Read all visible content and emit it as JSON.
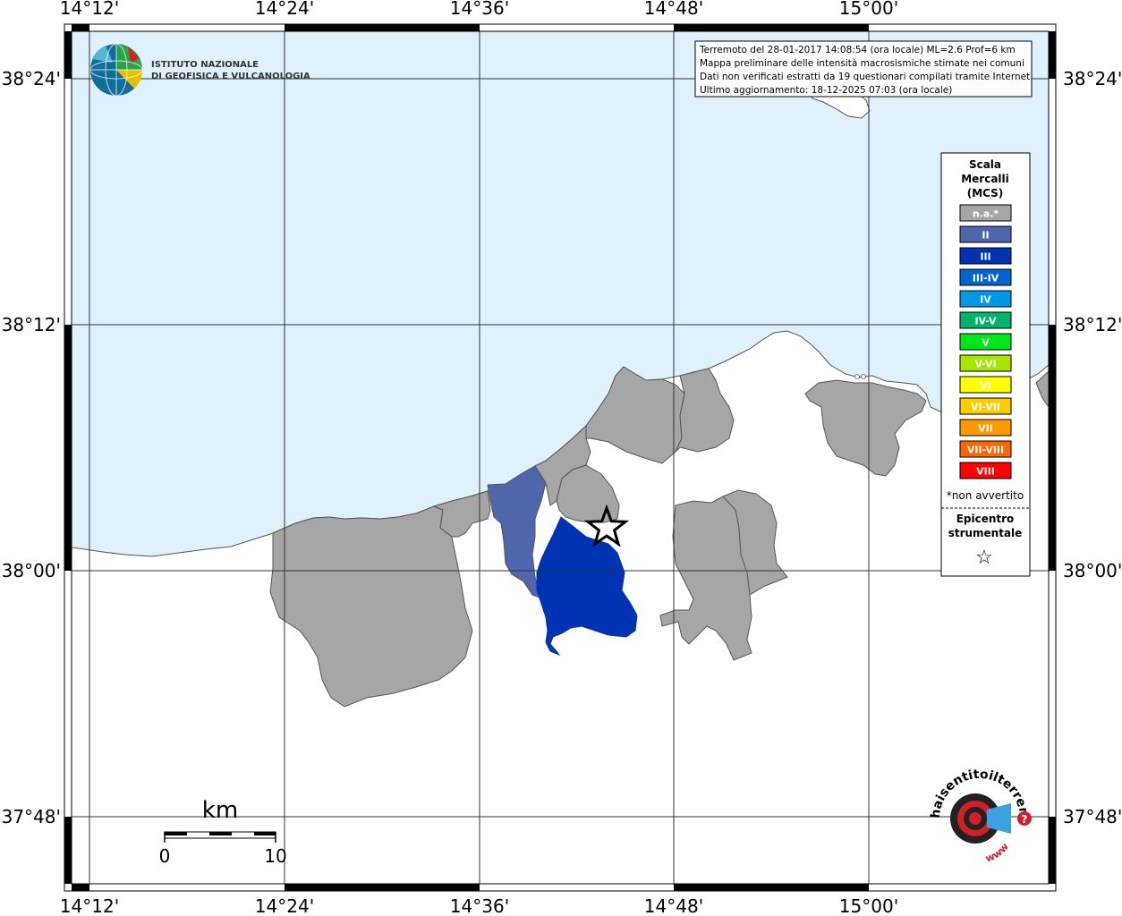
{
  "map": {
    "lon_labels": [
      "14°12'",
      "14°24'",
      "14°36'",
      "14°48'",
      "15°00'"
    ],
    "lat_labels": [
      "38°24'",
      "38°12'",
      "38°00'",
      "37°48'"
    ]
  },
  "header_logo": {
    "line1": "ISTITUTO NAZIONALE",
    "line2": "DI GEOFISICA E VULCANOLOGIA"
  },
  "info_box": {
    "line1": "Terremoto del 28-01-2017 14:08:54 (ora locale) ML=2.6 Prof=6 km",
    "line2": "Mappa preliminare delle intensità macrosismiche stimate nei comuni",
    "line3": "Dati non verificati estratti da 19 questionari compilati tramite Internet.",
    "line4": "Ultimo aggiornamento: 18-12-2025 07:03 (ora locale)"
  },
  "legend": {
    "title1": "Scala",
    "title2": "Mercalli",
    "title3": "(MCS)",
    "items": [
      {
        "label": "n.a.*",
        "color": "#a6a6a6"
      },
      {
        "label": "II",
        "color": "#4f66ad"
      },
      {
        "label": "III",
        "color": "#0033b3"
      },
      {
        "label": "III-IV",
        "color": "#0066cc"
      },
      {
        "label": "IV",
        "color": "#0099e6"
      },
      {
        "label": "IV-V",
        "color": "#00b36b"
      },
      {
        "label": "V",
        "color": "#00e61a"
      },
      {
        "label": "V-VI",
        "color": "#a6e600"
      },
      {
        "label": "VI",
        "color": "#ffff00"
      },
      {
        "label": "VI-VII",
        "color": "#ffcc00"
      },
      {
        "label": "VII",
        "color": "#ff9900"
      },
      {
        "label": "VII-VIII",
        "color": "#ff6600"
      },
      {
        "label": "VIII",
        "color": "#ff0000"
      }
    ],
    "note": "*non avvertito",
    "epicenter1": "Epicentro",
    "epicenter2": "strumentale",
    "epicenter_symbol": "☆"
  },
  "scale_bar": {
    "unit": "km",
    "min": "0",
    "max": "10"
  },
  "footer_logo": {
    "text_top": "haisentitoilterremoto.it",
    "text_bottom": "www.",
    "question": "?"
  },
  "colors": {
    "sea": "#dff1fd",
    "land": "#ffffff",
    "not_felt": "#a6a6a6",
    "intensity_II": "#4f66ad",
    "intensity_III": "#0033b3"
  }
}
